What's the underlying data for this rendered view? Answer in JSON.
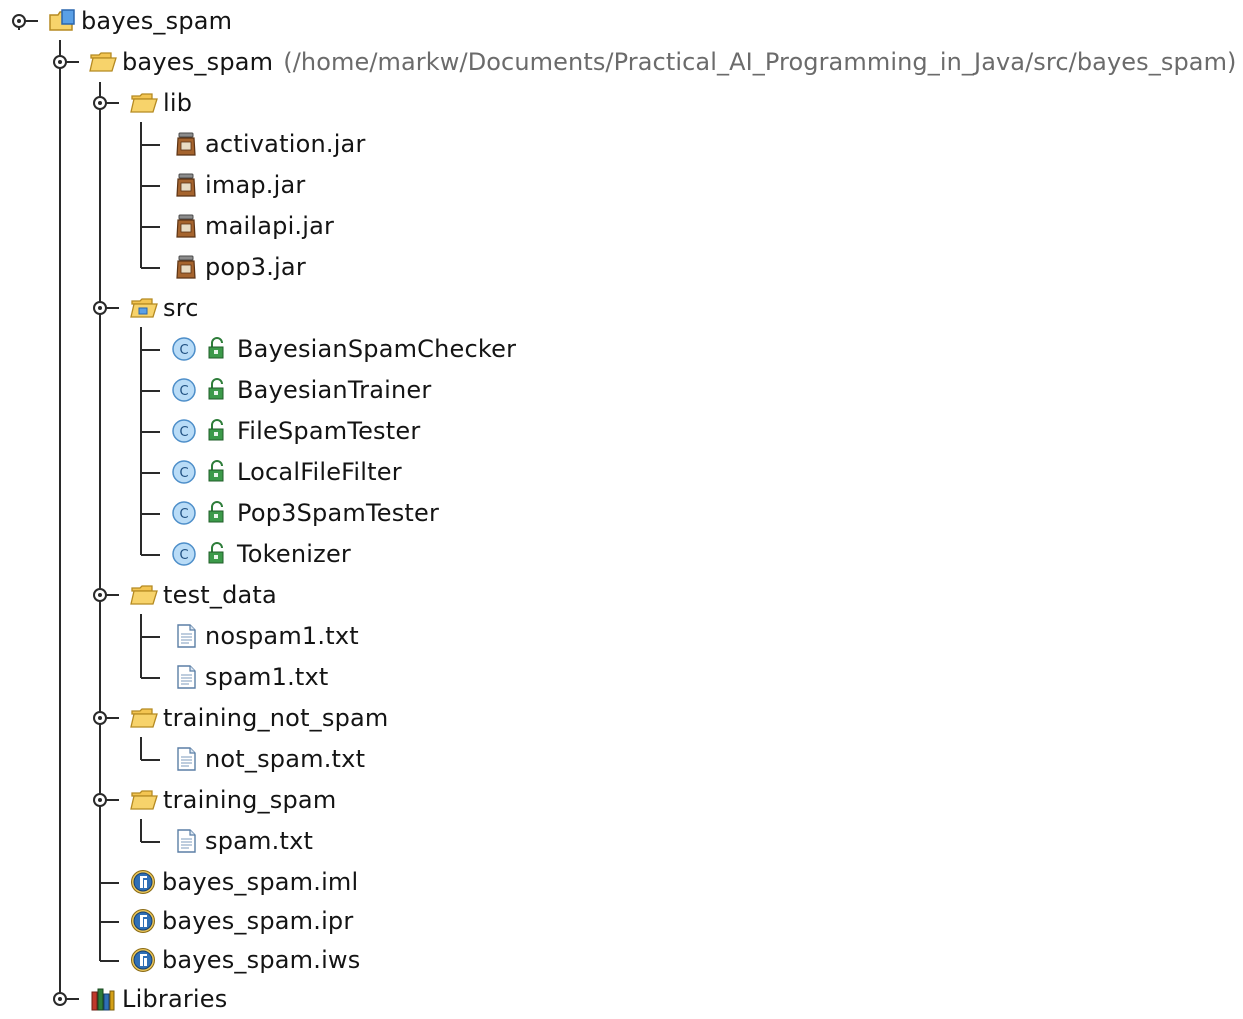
{
  "tree": {
    "root": {
      "label": "bayes_spam",
      "icon": "project-icon"
    },
    "module": {
      "label": "bayes_spam",
      "path": "(/home/markw/Documents/Practical_AI_Programming_in_Java/src/bayes_spam)",
      "icon": "open-folder-icon"
    },
    "lib": {
      "label": "lib",
      "items": [
        {
          "label": "activation.jar"
        },
        {
          "label": "imap.jar"
        },
        {
          "label": "mailapi.jar"
        },
        {
          "label": "pop3.jar"
        }
      ]
    },
    "src": {
      "label": "src",
      "items": [
        {
          "label": "BayesianSpamChecker"
        },
        {
          "label": "BayesianTrainer"
        },
        {
          "label": "FileSpamTester"
        },
        {
          "label": "LocalFileFilter"
        },
        {
          "label": "Pop3SpamTester"
        },
        {
          "label": "Tokenizer"
        }
      ]
    },
    "test_data": {
      "label": "test_data",
      "items": [
        {
          "label": "nospam1.txt"
        },
        {
          "label": "spam1.txt"
        }
      ]
    },
    "training_not_spam": {
      "label": "training_not_spam",
      "items": [
        {
          "label": "not_spam.txt"
        }
      ]
    },
    "training_spam": {
      "label": "training_spam",
      "items": [
        {
          "label": "spam.txt"
        }
      ]
    },
    "idea_files": [
      {
        "label": "bayes_spam.iml"
      },
      {
        "label": "bayes_spam.ipr"
      },
      {
        "label": "bayes_spam.iws"
      }
    ],
    "libraries": {
      "label": "Libraries"
    }
  },
  "colors": {
    "line": "#2a2a2a",
    "path_text": "#6b6b6b",
    "folder": "#f7d36b",
    "class_icon": "#8fc3ef",
    "idea_icon": "#2f6fb5"
  }
}
